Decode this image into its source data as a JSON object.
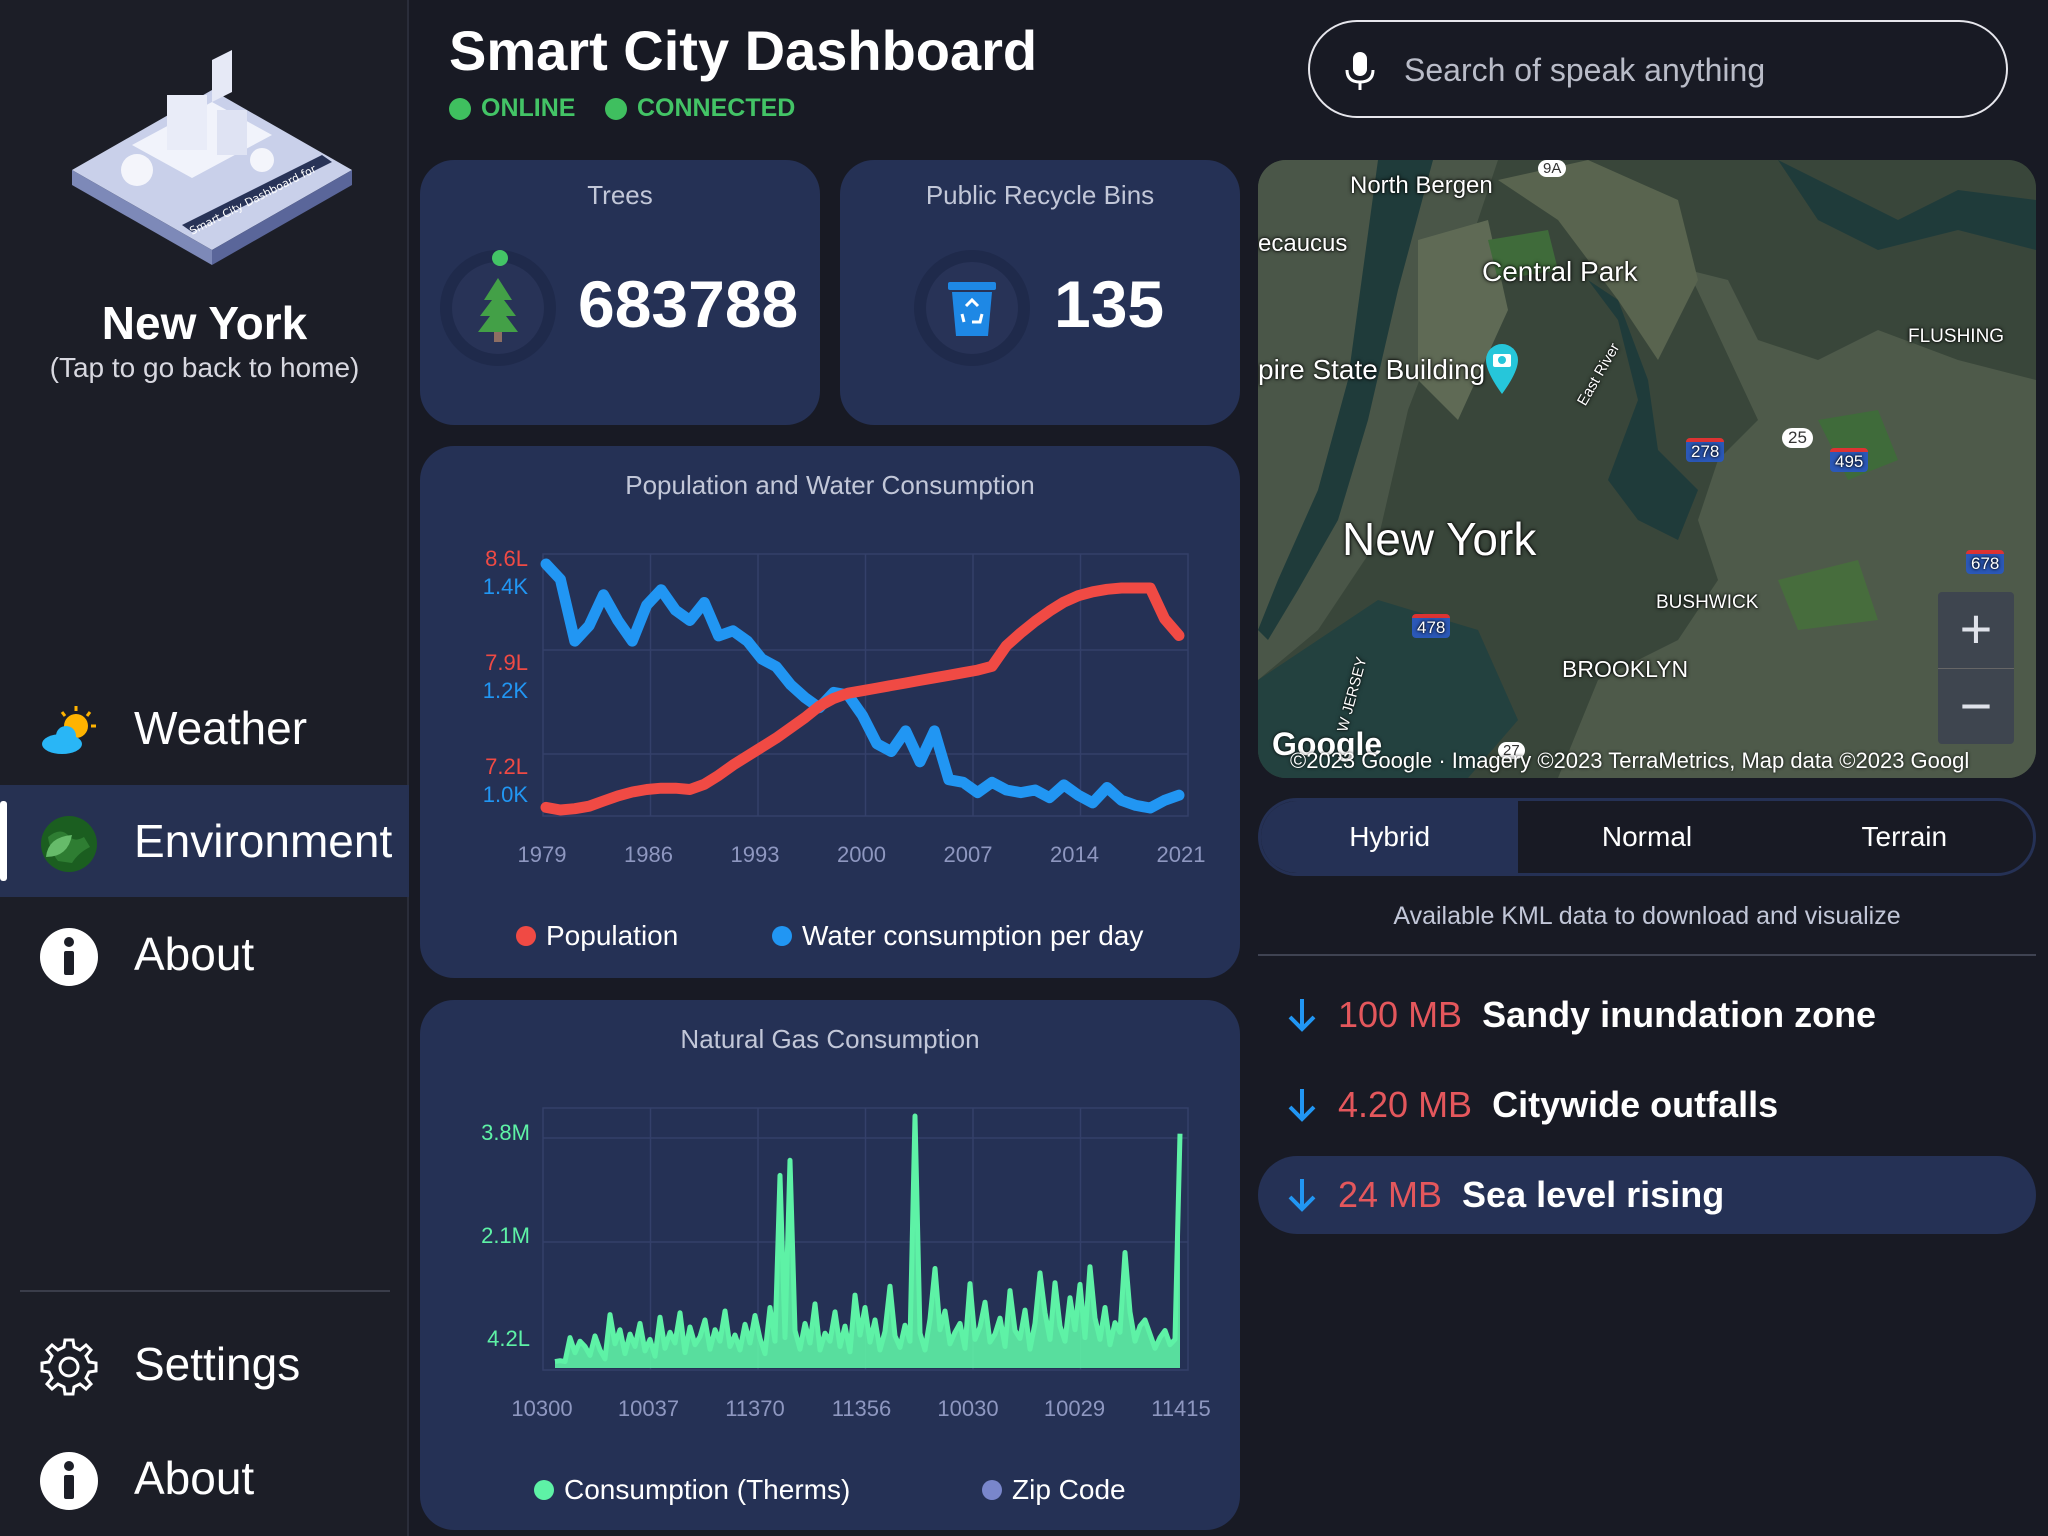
{
  "app": {
    "title": "Smart City Dashboard"
  },
  "status": {
    "online": "ONLINE",
    "connected": "CONNECTED"
  },
  "search": {
    "placeholder": "Search of speak anything",
    "icon": "mic-icon"
  },
  "sidebar": {
    "city": "New York",
    "subtitle": "(Tap to go back to home)",
    "illustration_caption": "Smart City Dashboard for",
    "items": [
      {
        "label": "Weather",
        "icon": "weather-icon",
        "active": false
      },
      {
        "label": "Environment",
        "icon": "environment-icon",
        "active": true
      },
      {
        "label": "About",
        "icon": "info-icon",
        "active": false
      }
    ],
    "bottom": [
      {
        "label": "Settings",
        "icon": "gear-icon"
      },
      {
        "label": "About",
        "icon": "info-icon"
      }
    ]
  },
  "stats": {
    "trees": {
      "title": "Trees",
      "value": "683788",
      "icon": "tree-icon"
    },
    "bins": {
      "title": "Public Recycle Bins",
      "value": "135",
      "icon": "recycle-bin-icon"
    }
  },
  "colors": {
    "population": "#f04a44",
    "water": "#2196f3",
    "gas": "#5ef2a6",
    "zip": "#7986cb",
    "card": "#253155",
    "online": "#43c466",
    "kml_size": "#e4575c"
  },
  "chart_data": [
    {
      "type": "line",
      "title": "Population and Water Consumption",
      "x_ticks": [
        "1979",
        "1986",
        "1993",
        "2000",
        "2007",
        "2014",
        "2021"
      ],
      "x": [
        1979,
        1980,
        1981,
        1982,
        1983,
        1984,
        1985,
        1986,
        1987,
        1988,
        1989,
        1990,
        1991,
        1992,
        1993,
        1994,
        1995,
        1996,
        1997,
        1998,
        1999,
        2000,
        2001,
        2002,
        2003,
        2004,
        2005,
        2006,
        2007,
        2008,
        2009,
        2010,
        2011,
        2012,
        2013,
        2014,
        2015,
        2016,
        2017,
        2018,
        2019,
        2020,
        2021,
        2022,
        2023
      ],
      "y_left_ticks": [
        "8.6L",
        "7.9L",
        "7.2L"
      ],
      "y_right_ticks": [
        "1.4K",
        "1.2K",
        "1.0K"
      ],
      "series": [
        {
          "name": "Population",
          "axis": "population",
          "values": [
            7.08,
            7.06,
            7.07,
            7.09,
            7.13,
            7.17,
            7.2,
            7.22,
            7.23,
            7.23,
            7.22,
            7.26,
            7.33,
            7.41,
            7.48,
            7.55,
            7.62,
            7.7,
            7.78,
            7.87,
            7.93,
            7.97,
            7.99,
            8.01,
            8.03,
            8.05,
            8.07,
            8.09,
            8.11,
            8.13,
            8.15,
            8.18,
            8.34,
            8.44,
            8.53,
            8.61,
            8.68,
            8.73,
            8.76,
            8.78,
            8.79,
            8.79,
            8.79,
            8.55,
            8.42
          ]
        },
        {
          "name": "Water consumption per day",
          "axis": "water",
          "values": [
            1.52,
            1.46,
            1.22,
            1.28,
            1.4,
            1.3,
            1.22,
            1.36,
            1.42,
            1.34,
            1.3,
            1.37,
            1.24,
            1.26,
            1.22,
            1.15,
            1.12,
            1.05,
            1.0,
            0.96,
            1.02,
            1.01,
            0.93,
            0.82,
            0.79,
            0.87,
            0.75,
            0.87,
            0.68,
            0.67,
            0.63,
            0.67,
            0.64,
            0.63,
            0.64,
            0.61,
            0.66,
            0.62,
            0.59,
            0.65,
            0.6,
            0.58,
            0.57,
            0.6,
            0.62
          ]
        }
      ]
    },
    {
      "type": "line",
      "title": "Natural Gas Consumption",
      "x_ticks": [
        "10300",
        "10037",
        "11370",
        "11356",
        "10030",
        "10029",
        "11415"
      ],
      "y_ticks": [
        "3.8M",
        "2.1M",
        "4.2L"
      ],
      "legend": [
        "Consumption (Therms)",
        "Zip Code"
      ],
      "series": [
        {
          "name": "Consumption (Therms)",
          "values": [
            0.05,
            0.06,
            0.05,
            0.32,
            0.15,
            0.28,
            0.22,
            0.12,
            0.34,
            0.18,
            0.08,
            0.58,
            0.25,
            0.41,
            0.14,
            0.36,
            0.22,
            0.48,
            0.17,
            0.3,
            0.11,
            0.55,
            0.2,
            0.38,
            0.26,
            0.6,
            0.15,
            0.44,
            0.24,
            0.33,
            0.52,
            0.19,
            0.41,
            0.28,
            0.62,
            0.22,
            0.35,
            0.18,
            0.47,
            0.26,
            0.57,
            0.31,
            0.14,
            0.66,
            0.28,
            2.15,
            0.32,
            2.32,
            0.4,
            0.19,
            0.48,
            0.26,
            0.7,
            0.18,
            0.37,
            0.28,
            0.61,
            0.22,
            0.45,
            0.16,
            0.8,
            0.35,
            0.66,
            0.27,
            0.52,
            0.18,
            0.39,
            0.9,
            0.34,
            0.21,
            0.46,
            0.28,
            2.82,
            0.37,
            0.18,
            0.53,
            1.1,
            0.41,
            0.62,
            0.25,
            0.38,
            0.48,
            0.2,
            0.93,
            0.3,
            0.44,
            0.72,
            0.27,
            0.36,
            0.54,
            0.22,
            0.85,
            0.4,
            0.31,
            0.63,
            0.19,
            0.48,
            1.05,
            0.6,
            0.3,
            0.94,
            0.45,
            0.28,
            0.77,
            0.41,
            0.92,
            0.32,
            1.12,
            0.54,
            0.3,
            0.66,
            0.24,
            0.49,
            0.38,
            1.28,
            0.61,
            0.28,
            0.45,
            0.52,
            0.36,
            0.2,
            0.32,
            0.4,
            0.24,
            0.3,
            2.62
          ]
        },
        {
          "name": "Zip Code",
          "values": []
        }
      ]
    }
  ],
  "map": {
    "labels": [
      "North Bergen",
      "ecaucus",
      "Central Park",
      "pire State Building",
      "FLUSHING",
      "New York",
      "BUSHWICK",
      "BROOKLYN",
      "East River",
      "W JERSEY"
    ],
    "shields": [
      "9A",
      "278",
      "25",
      "495",
      "678",
      "478",
      "27"
    ],
    "google": "Google",
    "copyright": "©2023 Google · Imagery ©2023 TerraMetrics, Map data ©2023 Googl",
    "zoom_in": "+",
    "zoom_out": "−",
    "types": [
      "Hybrid",
      "Normal",
      "Terrain"
    ],
    "selected_type": "Hybrid"
  },
  "kml": {
    "caption": "Available KML data to download and visualize",
    "items": [
      {
        "size": "100 MB",
        "name": "Sandy inundation zone"
      },
      {
        "size": "4.20 MB",
        "name": "Citywide outfalls"
      },
      {
        "size": "24 MB",
        "name": "Sea level rising"
      }
    ]
  }
}
